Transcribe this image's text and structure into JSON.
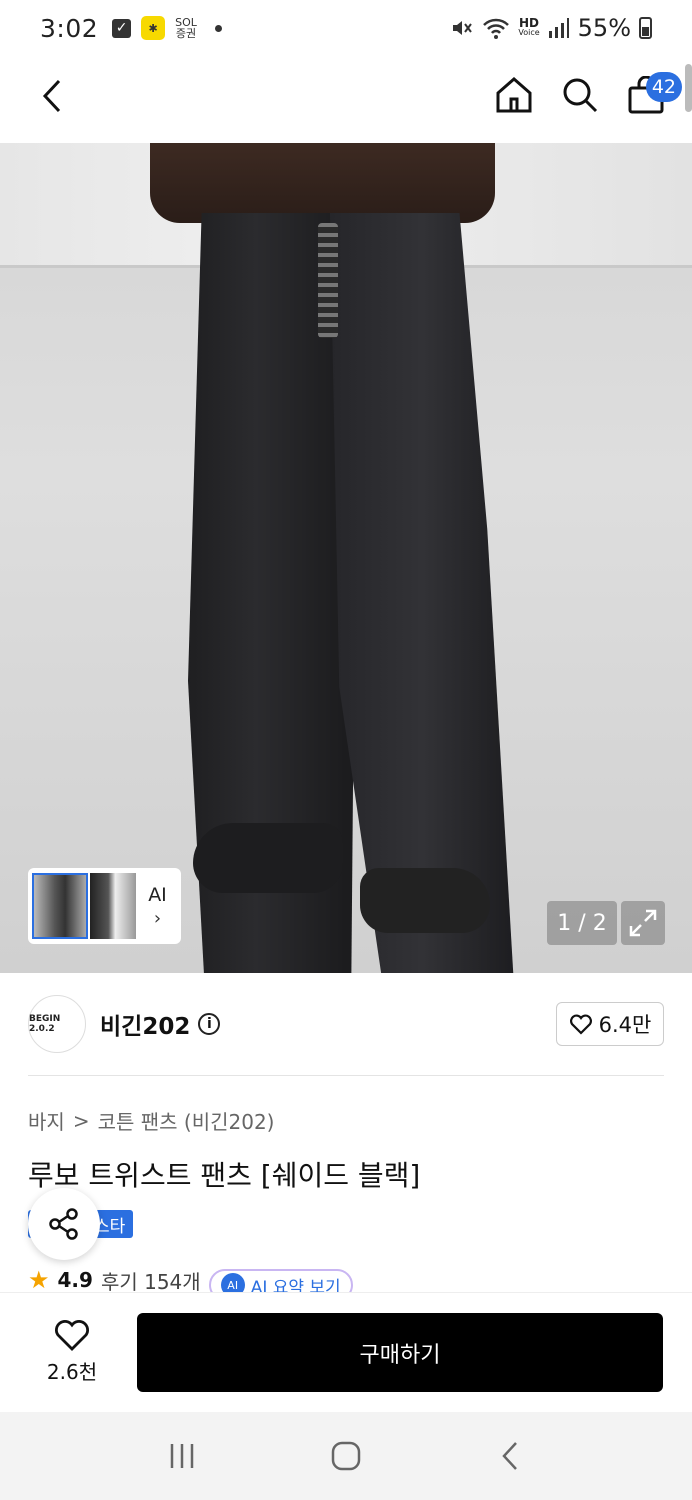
{
  "status_bar": {
    "time": "3:02",
    "icon_box_glyph": "✓",
    "yellow_glyph": "✱",
    "app_small_text_top": "SOL",
    "app_small_text_bottom": "증권",
    "hd_label": "HD",
    "voice_label": "Voice",
    "battery": "55%"
  },
  "header": {
    "cart_count": "42",
    "icons": [
      "back-icon",
      "home-icon",
      "search-icon",
      "cart-icon"
    ]
  },
  "gallery": {
    "ai_label": "AI",
    "ai_chevron": "›",
    "page_counter": "1 / 2"
  },
  "brand": {
    "logo_text": "BEGIN 2.0.2",
    "name": "비긴202",
    "info_glyph": "i",
    "likes": "6.4만"
  },
  "product": {
    "breadcrumb": [
      "바지",
      ">",
      "코튼 팬츠 (비긴202)"
    ],
    "title": "루보 트위스트 팬츠 [쉐이드 블랙]",
    "tag": "스타",
    "rating": "4.9",
    "reviews": "후기 154개",
    "ai_summary_icon": "AI",
    "ai_summary_label": "AI 요약 보기"
  },
  "bottom_bar": {
    "fav_count": "2.6천",
    "buy_label": "구매하기"
  },
  "colors": {
    "accent": "#2b6fe0",
    "buy_button": "#000000",
    "star": "#f5a300"
  }
}
